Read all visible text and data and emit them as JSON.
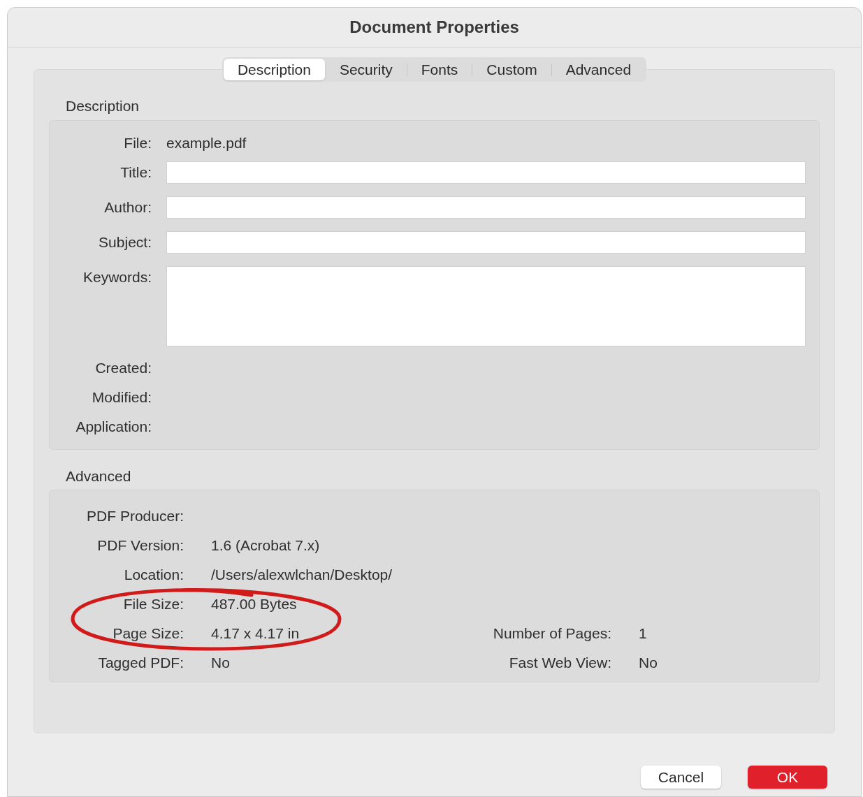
{
  "window": {
    "title": "Document Properties"
  },
  "tabs": [
    {
      "label": "Description",
      "selected": true
    },
    {
      "label": "Security",
      "selected": false
    },
    {
      "label": "Fonts",
      "selected": false
    },
    {
      "label": "Custom",
      "selected": false
    },
    {
      "label": "Advanced",
      "selected": false
    }
  ],
  "description": {
    "heading": "Description",
    "fields": [
      {
        "label": "File:",
        "kind": "text",
        "value": "example.pdf"
      },
      {
        "label": "Title:",
        "kind": "input"
      },
      {
        "label": "Author:",
        "kind": "input"
      },
      {
        "label": "Subject:",
        "kind": "input"
      },
      {
        "label": "Keywords:",
        "kind": "textarea"
      },
      {
        "label": "Created:",
        "kind": "text"
      },
      {
        "label": "Modified:",
        "kind": "text"
      },
      {
        "label": "Application:",
        "kind": "text"
      }
    ]
  },
  "advanced": {
    "heading": "Advanced",
    "rows": [
      {
        "label": "PDF Producer:"
      },
      {
        "label": "PDF Version:",
        "value": "1.6 (Acrobat 7.x)"
      },
      {
        "label": "Location:",
        "value": "/Users/alexwlchan/Desktop/"
      },
      {
        "label": "File Size:",
        "value": "487.00 Bytes"
      },
      {
        "label": "Page Size:",
        "value": "4.17 x 4.17 in",
        "right_label": "Number of Pages:",
        "right_value": "1"
      },
      {
        "label": "Tagged PDF:",
        "value": "No",
        "right_label": "Fast Web View:",
        "right_value": "No"
      }
    ]
  },
  "buttons": [
    {
      "label": "Cancel",
      "kind": "default"
    },
    {
      "label": "OK",
      "kind": "primary"
    }
  ]
}
